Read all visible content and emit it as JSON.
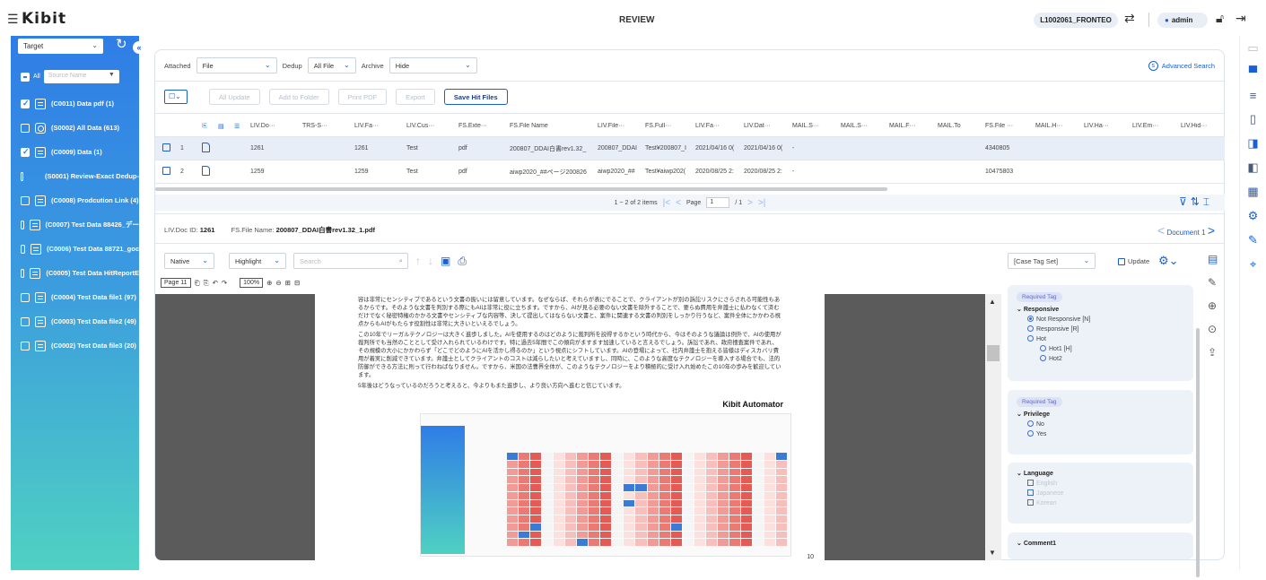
{
  "app": {
    "title": "REVIEW",
    "logo": "Kibit",
    "case_id": "L1002061_FRONTEO",
    "user": "admin"
  },
  "sidebar": {
    "target_label": "Target",
    "all_label": "All",
    "source_placeholder": "Source Name",
    "folders": [
      {
        "label": "(C0011) Data pdf (1)",
        "checked": true,
        "icon": "list-icon"
      },
      {
        "label": "(S0002) All Data (613)",
        "checked": false,
        "icon": "saved-search-icon"
      },
      {
        "label": "(C0009) Data (1)",
        "checked": true,
        "icon": "list-icon"
      },
      {
        "label": "(S0001) Review-Exact Dedup-",
        "checked": false,
        "icon": "locked-folder-icon"
      },
      {
        "label": "(C0008) Prodcution Link (4)",
        "checked": false,
        "icon": "list-icon"
      },
      {
        "label": "(C0007) Test Data 88426_デー",
        "checked": false,
        "icon": "list-icon"
      },
      {
        "label": "(C0006) Test Data 88721_goc",
        "checked": false,
        "icon": "list-icon"
      },
      {
        "label": "(C0005) Test Data HitReportE",
        "checked": false,
        "icon": "list-icon"
      },
      {
        "label": "(C0004) Test Data file1 (97)",
        "checked": false,
        "icon": "list-icon"
      },
      {
        "label": "(C0003) Test Data file2 (49)",
        "checked": false,
        "icon": "list-icon"
      },
      {
        "label": "(C0002) Test Data file3 (20)",
        "checked": false,
        "icon": "list-icon"
      }
    ]
  },
  "filters": {
    "attached_label": "Attached",
    "attached_value": "File",
    "dedup_label": "Dedup",
    "dedup_value": "All File",
    "archive_label": "Archive",
    "archive_value": "Hide",
    "advanced_search": "Advanced Search"
  },
  "toolbar": {
    "all_update": "All Update",
    "add_to_folder": "Add to Folder",
    "print_pdf": "Print PDF",
    "export": "Export",
    "save_hit_files": "Save Hit Files"
  },
  "grid": {
    "columns": [
      "LIV.Do···",
      "TRS-S···",
      "LIV.Fa···",
      "LIV.Cus···",
      "FS.Exte···",
      "FS.File Name",
      "LIV.File···",
      "FS.Full···",
      "LIV.Fa···",
      "LIV.Dat···",
      "MAIL.S···",
      "MAIL.S···",
      "MAIL.F···",
      "MAIL.To",
      "FS.File ···",
      "MAIL.H···",
      "LIV.Ha···",
      "LIV.Em···",
      "LIV.Hid···"
    ],
    "rows": [
      {
        "n": "1",
        "cells": [
          "1261",
          "",
          "1261",
          "Test",
          "pdf",
          "200807_DDAI白書rev1.32_",
          "200807_DDAI",
          "Test¥200807_I",
          "2021/04/16 0(",
          "2021/04/16 0(",
          "-",
          "",
          "",
          "",
          "4340805",
          "",
          "",
          "",
          ""
        ]
      },
      {
        "n": "2",
        "cells": [
          "1259",
          "",
          "1259",
          "Test",
          "pdf",
          "aiwp2020_##ページ200826",
          "aiwp2020_##",
          "Test¥aiwp202(",
          "2020/08/25 2:",
          "2020/08/25 2:",
          "-",
          "",
          "",
          "",
          "10475803",
          "",
          "",
          "",
          ""
        ]
      }
    ]
  },
  "pager": {
    "summary": "1 ~ 2 of 2 items",
    "page_label": "Page",
    "page_value": "1",
    "page_total": "/ 1"
  },
  "docinfo": {
    "id_label": "LIV.Doc ID:",
    "id_value": "1261",
    "name_label": "FS.File Name:",
    "name_value": "200807_DDAI白書rev1.32_1.pdf",
    "nav_label": "Document 1"
  },
  "viewer": {
    "mode": "Native",
    "highlight": "Highlight",
    "search_placeholder": "Search",
    "page_select": "Page 11",
    "zoom": "100%",
    "paragraphs": [
      "容は非常にセンシティブであるという文書の扱いには留意しています。なぜならば、それらが表にでることで、クライアントが別の訴訟リスクにさらされる可能性もあるからです。そのような文書を判別する際にもAIは非常に役に立ちます。ですから、AIが見る必要のない文書を除外することで、要らぬ費用を弁護士に払わなくて済むだけでなく秘密特権のかかる文書やセンシティブな内容等、決して提出してはならない文書と、案件に関連する文書の判別をしっかり行うなど、案件全体にかかわる視点からもAIがもたらす役割性は非常に大きいといえるでしょう。",
      "この10年でリーガルテクノロジーは大きく進歩しました。AIを使用するのはどのように裁判所を説得するかという時代から、今はそのような議論は例外で、AIの使用が裁判所でも当然のこととして受け入れられているわけです。特に過去5年間でこの傾向がますます加速していると言えるでしょう。訴訟であれ、政府捜査案件であれ、その規模の大小にかかわらず「どこでどのようにAIを活かし得るのか」という視点にシフトしています。AIの登場によって、社内弁護士を抱える皆様はディスカバリ費用が着実に削減できています。弁護士としてクライアントのコストは減らしたいと考えていますし、同時に、このような高度なテクノロジーを導入する場合でも、法的防御ができる方法に則って行わねばなりません。ですから、米国の法曹界全体が、このようなテクノロジーをより積極的に受け入れ始めたこの10年の歩みを歓迎しています。",
      "5年後はどうなっているのだろうと考えると、今よりもまた進歩し、より良い方向へ進むと信じています。"
    ],
    "automator": "Kibit Automator",
    "page_number": "10"
  },
  "tags": {
    "tagset": "[Case Tag Set]",
    "update": "Update",
    "required": "Required Tag",
    "responsive": {
      "title": "Responsive",
      "items": [
        "Not Responsive  [N]",
        "Responsive  [R]",
        "Hot",
        "Hot1  [H]",
        "Hot2"
      ]
    },
    "privilege": {
      "title": "Privilege",
      "items": [
        "No",
        "Yes"
      ]
    },
    "language": {
      "title": "Language",
      "items": [
        "English",
        "Japanese",
        "Korean"
      ]
    },
    "comment": {
      "title": "Comment1"
    }
  }
}
